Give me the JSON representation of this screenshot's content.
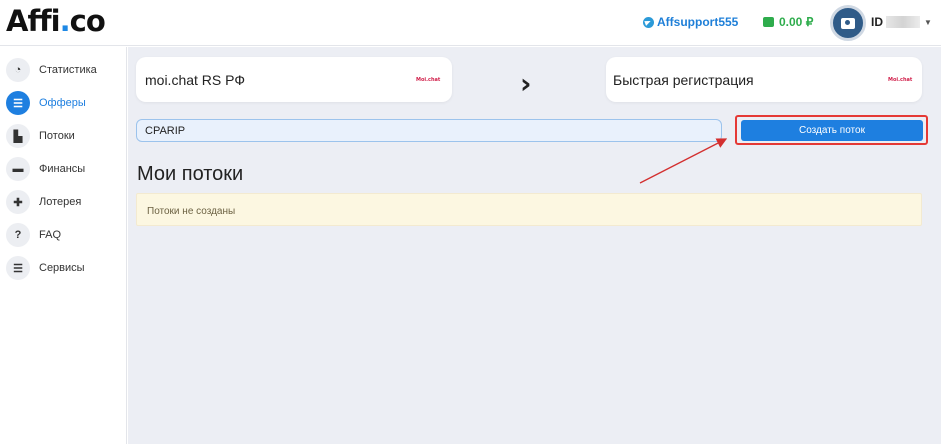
{
  "header": {
    "logo_main": "Affi",
    "logo_dot": ".",
    "logo_tld": "co",
    "support_label": "Affsupport555",
    "balance": "0.00 ₽",
    "user_label": "ID"
  },
  "sidebar": {
    "items": [
      {
        "label": "Статистика",
        "icon": "pie-chart-icon",
        "glyph": "◔"
      },
      {
        "label": "Офферы",
        "icon": "list-icon",
        "glyph": "☰"
      },
      {
        "label": "Потоки",
        "icon": "door-icon",
        "glyph": "▙"
      },
      {
        "label": "Финансы",
        "icon": "wallet-icon",
        "glyph": "▬"
      },
      {
        "label": "Лотерея",
        "icon": "gift-icon",
        "glyph": "✚"
      },
      {
        "label": "FAQ",
        "icon": "question-icon",
        "glyph": "?"
      },
      {
        "label": "Сервисы",
        "icon": "list-icon",
        "glyph": "☰"
      }
    ],
    "active_index": 1
  },
  "offer": {
    "title": "moi.chat RS РФ",
    "brand": "Moi.chat",
    "arrow": "›",
    "target_title": "Быстрая регистрация",
    "target_brand": "Moi.chat"
  },
  "form": {
    "promo_value": "CPARIP",
    "create_button": "Создать поток"
  },
  "streams": {
    "title": "Мои потоки",
    "empty_message": "Потоки не созданы"
  },
  "colors": {
    "accent": "#1e7fe0",
    "balance": "#2eac4c",
    "highlight": "#e53935",
    "empty_bg": "#fcf7e1"
  }
}
